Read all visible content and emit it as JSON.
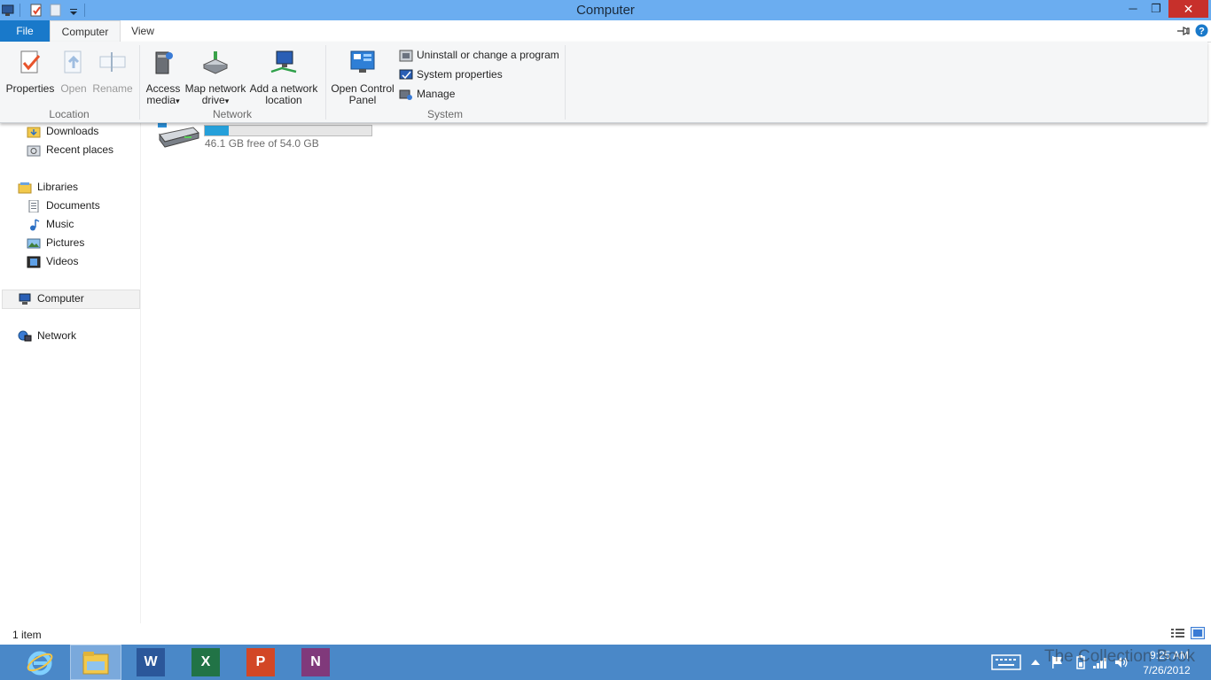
{
  "window": {
    "title": "Computer",
    "controls": {
      "minimize": "─",
      "restore": "❐",
      "close": "✕"
    }
  },
  "tabs": {
    "file": "File",
    "computer": "Computer",
    "view": "View"
  },
  "ribbon": {
    "location": {
      "label": "Location",
      "properties": "Properties",
      "open": "Open",
      "rename": "Rename"
    },
    "network": {
      "label": "Network",
      "access_media_line1": "Access",
      "access_media_line2": "media",
      "map_drive_line1": "Map network",
      "map_drive_line2": "drive",
      "add_location_line1": "Add a network",
      "add_location_line2": "location"
    },
    "system": {
      "label": "System",
      "control_panel_line1": "Open Control",
      "control_panel_line2": "Panel",
      "uninstall": "Uninstall or change a program",
      "system_properties": "System properties",
      "manage": "Manage"
    },
    "dropdown_arrow": "▾"
  },
  "nav": {
    "downloads": "Downloads",
    "recent_places": "Recent places",
    "libraries": "Libraries",
    "documents": "Documents",
    "music": "Music",
    "pictures": "Pictures",
    "videos": "Videos",
    "computer": "Computer",
    "network": "Network"
  },
  "drive": {
    "free_text": "46.1 GB free of 54.0 GB",
    "used_fraction": 0.146
  },
  "status": {
    "item_count": "1 item"
  },
  "taskbar": {
    "word_letter": "W",
    "excel_letter": "X",
    "powerpoint_letter": "P",
    "onenote_letter": "N",
    "time": "9:25 AM",
    "date": "7/26/2012",
    "watermark": "The Collection Book"
  },
  "colors": {
    "titlebar": "#6badf0",
    "file_tab": "#1979ca",
    "close": "#c7302b",
    "taskbar": "#4a88c8",
    "drive_fill": "#26a0da"
  }
}
